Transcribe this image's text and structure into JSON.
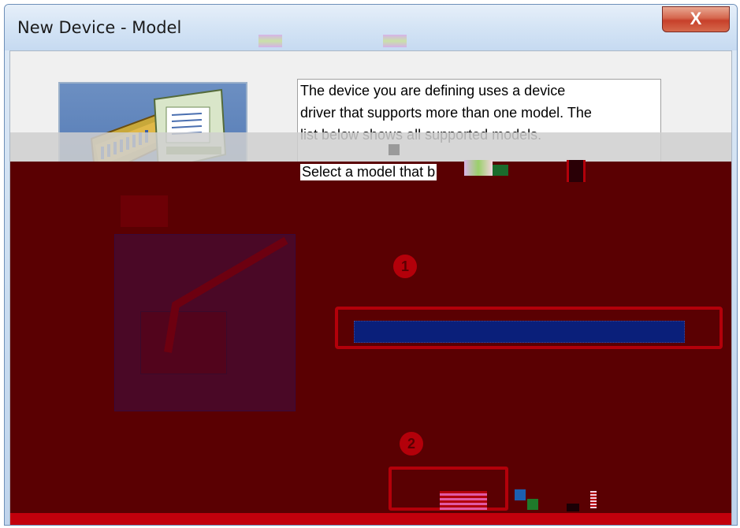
{
  "window": {
    "title": "New Device - Model",
    "close_label": "X"
  },
  "description": {
    "text": "The device you are defining uses a device\ndriver that supports more than one model.  The\nlist below shows all supported models.",
    "select_prompt": "Select  a model that b"
  },
  "steps": [
    {
      "label": "1"
    },
    {
      "label": "2"
    }
  ],
  "colors": {
    "redaction": "#5a0002",
    "highlight": "#b3000a",
    "selection": "#0a1f7a"
  }
}
